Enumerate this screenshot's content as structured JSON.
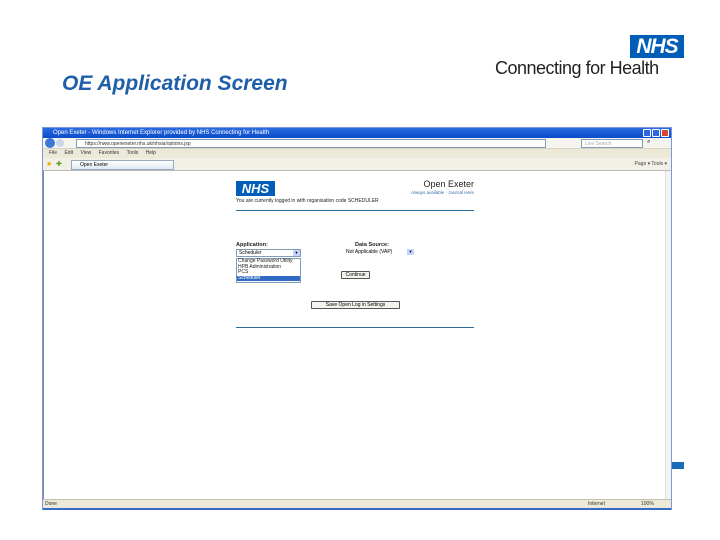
{
  "slide": {
    "title": "OE Application Screen",
    "logo_text": "NHS",
    "tagline": "Connecting for Health"
  },
  "browser": {
    "title": "Open Exeter - Windows Internet Explorer provided by NHS Connecting for Health",
    "url": "https://nww.openexeter.nhs.uk/nhsia/options.jsp",
    "search_placeholder": "Live Search",
    "menu": [
      "File",
      "Edit",
      "View",
      "Favorites",
      "Tools",
      "Help"
    ],
    "tab": "Open Exeter",
    "tools": "Page ▾  Tools ▾",
    "status": "Done",
    "zone": "Internet",
    "zoom": "100%"
  },
  "page": {
    "logo_text": "NHS",
    "app_name": "Open Exeter",
    "links": "Always available · Journal Here",
    "logged_in": "You are currently logged in with organisation code SCHEDULER",
    "application_label": "Application:",
    "application_value": "Scheduler",
    "application_options": [
      "Change Password Utility",
      "HPB Administration",
      "PCS",
      "Scheduler"
    ],
    "selected_option": "Scheduler",
    "datasource_label": "Data Source:",
    "datasource_value": "Not Applicable (VAP)",
    "continue_label": "Continue",
    "save_label": "Save Open Log in Settings"
  }
}
